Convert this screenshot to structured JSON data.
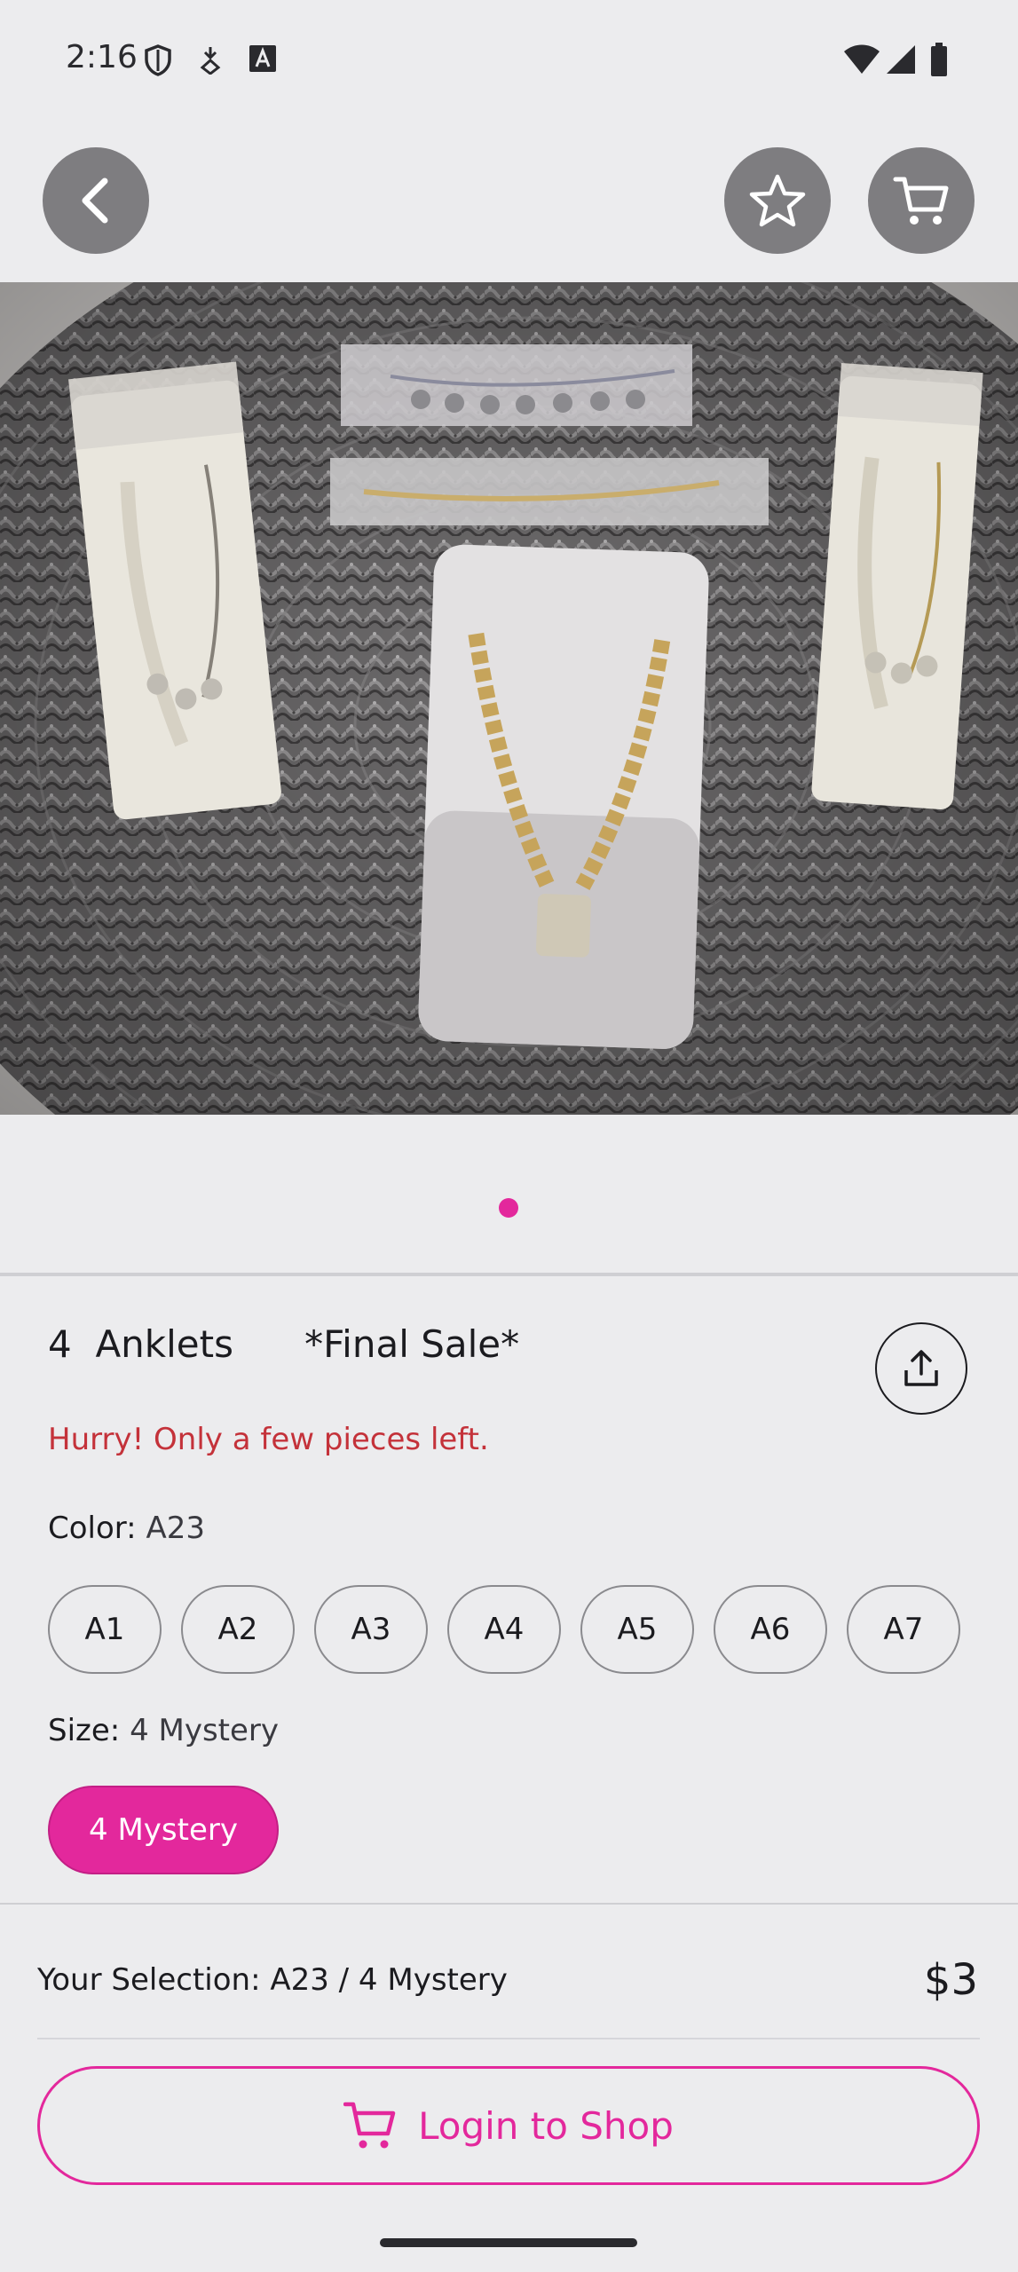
{
  "status_bar": {
    "time": "2:16",
    "icons": [
      "shield-icon",
      "download-icon",
      "font-icon",
      "wifi-icon",
      "signal-icon",
      "battery-icon"
    ]
  },
  "nav": {
    "back_icon": "chevron-left-icon",
    "favorite_icon": "star-icon",
    "cart_icon": "cart-icon"
  },
  "product": {
    "image_pages": 1,
    "current_page": 1,
    "title_qty": "4",
    "title_name": "Anklets",
    "title_tag": "*Final Sale*",
    "stock_message": "Hurry! Only a few pieces left."
  },
  "color": {
    "label": "Color:",
    "selected": "A23",
    "options": [
      "A1",
      "A2",
      "A3",
      "A4",
      "A5",
      "A6",
      "A7"
    ]
  },
  "size": {
    "label": "Size:",
    "selected": "4 Mystery",
    "options": [
      "4 Mystery"
    ]
  },
  "summary": {
    "selection_text": "Your Selection: A23 / 4 Mystery",
    "price": "$3"
  },
  "cta": {
    "label": "Login to Shop",
    "icon": "cart-icon"
  },
  "colors": {
    "accent": "#e3289c",
    "warning": "#c4323a",
    "nav_button": "#7e7d80",
    "background": "#ececee"
  }
}
